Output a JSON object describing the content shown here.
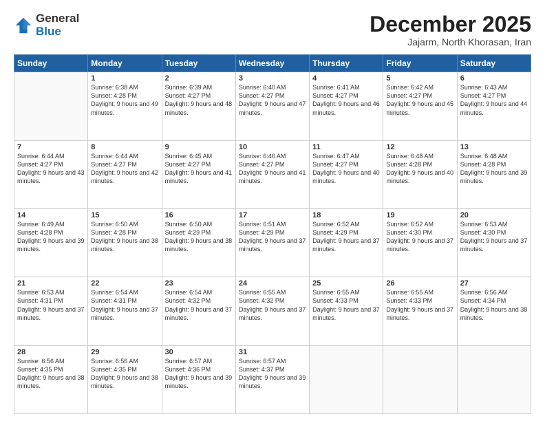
{
  "logo": {
    "general": "General",
    "blue": "Blue"
  },
  "header": {
    "month": "December 2025",
    "location": "Jajarm, North Khorasan, Iran"
  },
  "weekdays": [
    "Sunday",
    "Monday",
    "Tuesday",
    "Wednesday",
    "Thursday",
    "Friday",
    "Saturday"
  ],
  "weeks": [
    [
      {
        "day": null
      },
      {
        "day": 1,
        "sunrise": "6:38 AM",
        "sunset": "4:28 PM",
        "daylight": "9 hours and 49 minutes."
      },
      {
        "day": 2,
        "sunrise": "6:39 AM",
        "sunset": "4:27 PM",
        "daylight": "9 hours and 48 minutes."
      },
      {
        "day": 3,
        "sunrise": "6:40 AM",
        "sunset": "4:27 PM",
        "daylight": "9 hours and 47 minutes."
      },
      {
        "day": 4,
        "sunrise": "6:41 AM",
        "sunset": "4:27 PM",
        "daylight": "9 hours and 46 minutes."
      },
      {
        "day": 5,
        "sunrise": "6:42 AM",
        "sunset": "4:27 PM",
        "daylight": "9 hours and 45 minutes."
      },
      {
        "day": 6,
        "sunrise": "6:43 AM",
        "sunset": "4:27 PM",
        "daylight": "9 hours and 44 minutes."
      }
    ],
    [
      {
        "day": 7,
        "sunrise": "6:44 AM",
        "sunset": "4:27 PM",
        "daylight": "9 hours and 43 minutes."
      },
      {
        "day": 8,
        "sunrise": "6:44 AM",
        "sunset": "4:27 PM",
        "daylight": "9 hours and 42 minutes."
      },
      {
        "day": 9,
        "sunrise": "6:45 AM",
        "sunset": "4:27 PM",
        "daylight": "9 hours and 41 minutes."
      },
      {
        "day": 10,
        "sunrise": "6:46 AM",
        "sunset": "4:27 PM",
        "daylight": "9 hours and 41 minutes."
      },
      {
        "day": 11,
        "sunrise": "6:47 AM",
        "sunset": "4:27 PM",
        "daylight": "9 hours and 40 minutes."
      },
      {
        "day": 12,
        "sunrise": "6:48 AM",
        "sunset": "4:28 PM",
        "daylight": "9 hours and 40 minutes."
      },
      {
        "day": 13,
        "sunrise": "6:48 AM",
        "sunset": "4:28 PM",
        "daylight": "9 hours and 39 minutes."
      }
    ],
    [
      {
        "day": 14,
        "sunrise": "6:49 AM",
        "sunset": "4:28 PM",
        "daylight": "9 hours and 39 minutes."
      },
      {
        "day": 15,
        "sunrise": "6:50 AM",
        "sunset": "4:28 PM",
        "daylight": "9 hours and 38 minutes."
      },
      {
        "day": 16,
        "sunrise": "6:50 AM",
        "sunset": "4:29 PM",
        "daylight": "9 hours and 38 minutes."
      },
      {
        "day": 17,
        "sunrise": "6:51 AM",
        "sunset": "4:29 PM",
        "daylight": "9 hours and 37 minutes."
      },
      {
        "day": 18,
        "sunrise": "6:52 AM",
        "sunset": "4:29 PM",
        "daylight": "9 hours and 37 minutes."
      },
      {
        "day": 19,
        "sunrise": "6:52 AM",
        "sunset": "4:30 PM",
        "daylight": "9 hours and 37 minutes."
      },
      {
        "day": 20,
        "sunrise": "6:53 AM",
        "sunset": "4:30 PM",
        "daylight": "9 hours and 37 minutes."
      }
    ],
    [
      {
        "day": 21,
        "sunrise": "6:53 AM",
        "sunset": "4:31 PM",
        "daylight": "9 hours and 37 minutes."
      },
      {
        "day": 22,
        "sunrise": "6:54 AM",
        "sunset": "4:31 PM",
        "daylight": "9 hours and 37 minutes."
      },
      {
        "day": 23,
        "sunrise": "6:54 AM",
        "sunset": "4:32 PM",
        "daylight": "9 hours and 37 minutes."
      },
      {
        "day": 24,
        "sunrise": "6:55 AM",
        "sunset": "4:32 PM",
        "daylight": "9 hours and 37 minutes."
      },
      {
        "day": 25,
        "sunrise": "6:55 AM",
        "sunset": "4:33 PM",
        "daylight": "9 hours and 37 minutes."
      },
      {
        "day": 26,
        "sunrise": "6:55 AM",
        "sunset": "4:33 PM",
        "daylight": "9 hours and 37 minutes."
      },
      {
        "day": 27,
        "sunrise": "6:56 AM",
        "sunset": "4:34 PM",
        "daylight": "9 hours and 38 minutes."
      }
    ],
    [
      {
        "day": 28,
        "sunrise": "6:56 AM",
        "sunset": "4:35 PM",
        "daylight": "9 hours and 38 minutes."
      },
      {
        "day": 29,
        "sunrise": "6:56 AM",
        "sunset": "4:35 PM",
        "daylight": "9 hours and 38 minutes."
      },
      {
        "day": 30,
        "sunrise": "6:57 AM",
        "sunset": "4:36 PM",
        "daylight": "9 hours and 39 minutes."
      },
      {
        "day": 31,
        "sunrise": "6:57 AM",
        "sunset": "4:37 PM",
        "daylight": "9 hours and 39 minutes."
      },
      {
        "day": null
      },
      {
        "day": null
      },
      {
        "day": null
      }
    ]
  ]
}
